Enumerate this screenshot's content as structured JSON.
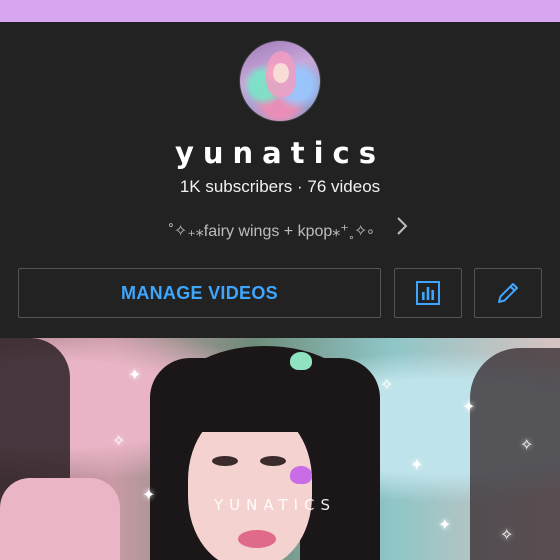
{
  "channel": {
    "name": "yunatics",
    "stats": "1K subscribers · 76 videos",
    "description": "˚✧₊⁎fairy wings + kpop⁎⁺˳✧༚"
  },
  "actions": {
    "manage_label": "MANAGE VIDEOS",
    "analytics_icon": "bar-chart-icon",
    "edit_icon": "pencil-icon"
  },
  "banner": {
    "watermark": "YUNATICS"
  },
  "colors": {
    "top_band": "#d8a6f0",
    "background": "#222222",
    "accent_blue": "#3ea6ff",
    "button_border": "#555555"
  }
}
